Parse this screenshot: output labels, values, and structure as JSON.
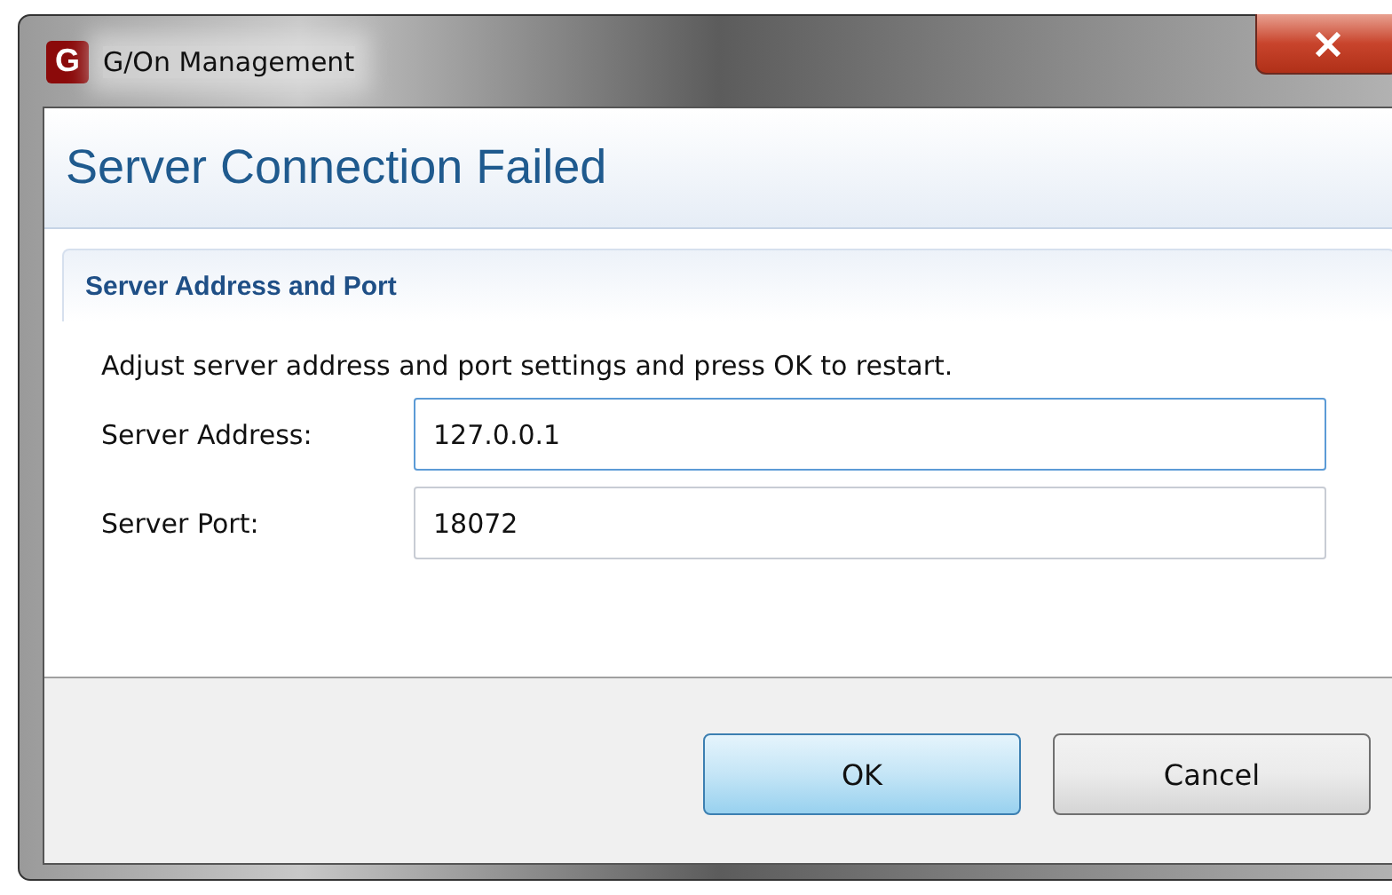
{
  "window": {
    "logo": "G",
    "title": "G/On Management"
  },
  "header": {
    "title": "Server Connection Failed"
  },
  "section": {
    "title": "Server Address and Port",
    "instruction": "Adjust server address and port settings and press OK to restart.",
    "fields": [
      {
        "label": "Server Address:",
        "value": "127.0.0.1",
        "focused": true
      },
      {
        "label": "Server Port:",
        "value": "18072",
        "focused": false
      }
    ]
  },
  "buttons": [
    {
      "label": "OK",
      "default": true
    },
    {
      "label": "Cancel",
      "default": false
    }
  ]
}
